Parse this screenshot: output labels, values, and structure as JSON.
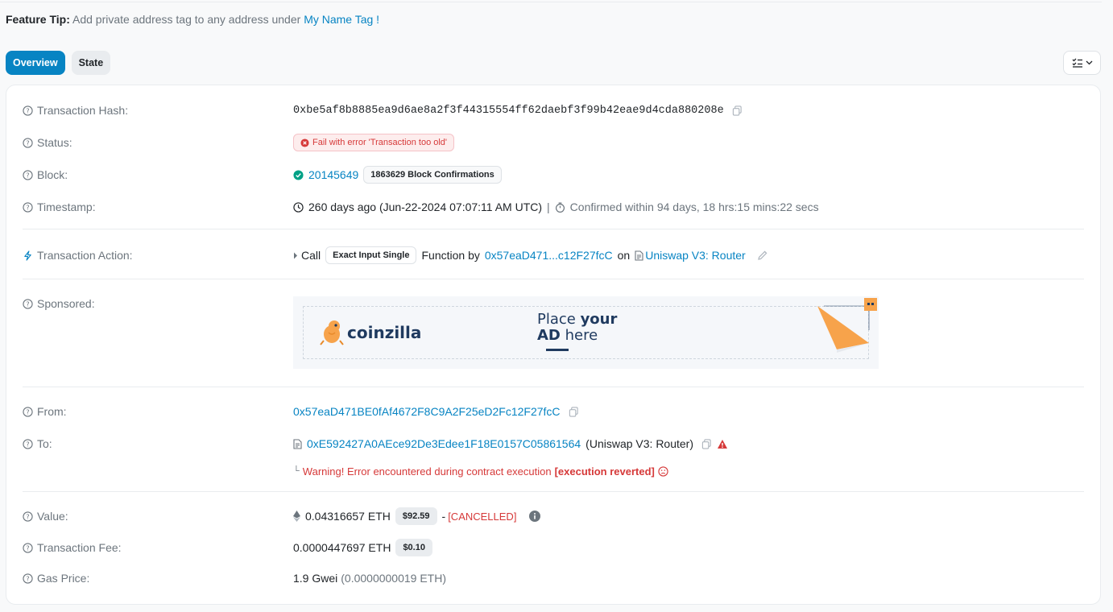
{
  "tip": {
    "label": "Feature Tip:",
    "text": "Add private address tag to any address under",
    "link": "My Name Tag !"
  },
  "tabs": [
    {
      "label": "Overview",
      "active": true
    },
    {
      "label": "State",
      "active": false
    }
  ],
  "tx": {
    "hash_label": "Transaction Hash:",
    "hash": "0xbe5af8b8885ea9d6ae8a2f3f44315554ff62daebf3f99b42eae9d4cda880208e",
    "status_label": "Status:",
    "status": "Fail with error 'Transaction too old'",
    "block_label": "Block:",
    "block": "20145649",
    "confirmations": "1863629 Block Confirmations",
    "timestamp_label": "Timestamp:",
    "timestamp": "260 days ago (Jun-22-2024 07:07:11 AM UTC)",
    "separator": "|",
    "confirmed_within": "Confirmed within 94 days, 18 hrs:15 mins:22 secs",
    "action_label": "Transaction Action:",
    "action_call": "Call",
    "action_method": "Exact Input Single",
    "action_function_by": "Function by",
    "action_from_short": "0x57eaD471...c12F27fcC",
    "action_on": "on",
    "action_contract": "Uniswap V3: Router",
    "sponsored_label": "Sponsored:",
    "from_label": "From:",
    "from": "0x57eaD471BE0fAf4672F8C9A2F25eD2Fc12F27fcC",
    "to_label": "To:",
    "to": "0xE592427A0AEce92De3Edee1F18E0157C05861564",
    "to_name": "(Uniswap V3: Router)",
    "warning_prefix": "Warning! Error encountered during contract execution",
    "warning_bold": "[execution reverted]",
    "value_label": "Value:",
    "value": "0.04316657 ETH",
    "value_usd": "$92.59",
    "value_dash": "-",
    "value_status": "[CANCELLED]",
    "fee_label": "Transaction Fee:",
    "fee": "0.0000447697 ETH",
    "fee_usd": "$0.10",
    "gas_label": "Gas Price:",
    "gas": "1.9 Gwei",
    "gas_eth": "(0.0000000019 ETH)"
  },
  "ad": {
    "brand": "coinzilla",
    "line1a": "Place ",
    "line1b": "your",
    "line2a": "AD",
    "line2b": " here"
  },
  "colors": {
    "link": "#0784c3",
    "error": "#d63939",
    "success": "#00a186",
    "ad_accent": "#f7a34b",
    "ad_navy": "#1f3a5f"
  }
}
